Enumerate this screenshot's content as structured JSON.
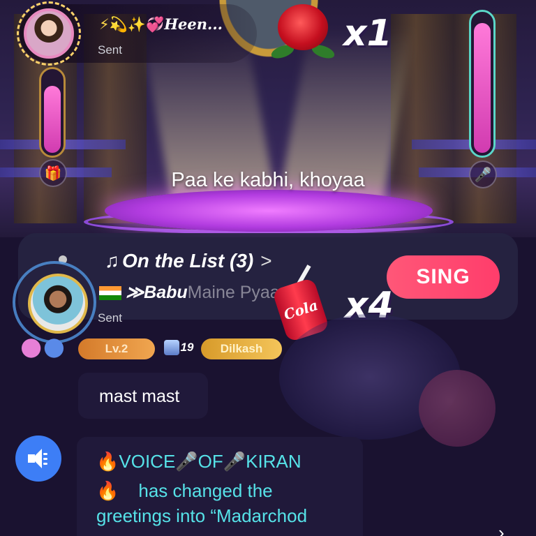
{
  "stage": {
    "lyric": "Paa ke kabhi, khoyaa"
  },
  "gift_banner_top": {
    "sender_emoji": "⚡💫✨💞",
    "sender_name": "Heen...",
    "status": "Sent",
    "multiplier": "x1",
    "gift": "rose-icon"
  },
  "song_list": {
    "title": "On the List (3)",
    "chevron": ">",
    "song_name": "≫Babu",
    "song_sub": "Maine Pyaam Li",
    "sing_label": "SING"
  },
  "gift_banner_second": {
    "status": "Sent",
    "multiplier": "x4",
    "gift_label": "Cola"
  },
  "badges": {
    "level": "Lv.2",
    "rank": "19",
    "club": "Dilkash"
  },
  "chat": {
    "messages": [
      {
        "text": "mast mast"
      }
    ],
    "notice": {
      "line1": "VOICE🎤OF🎤KIRAN",
      "line2": "has changed the",
      "line3": "greetings into “Madarchod"
    }
  },
  "colors": {
    "sing_button": "#ff4a70",
    "notice_text": "#56e2e8",
    "speaker_button": "#3d7ef6",
    "level_badge": "#e08a36"
  }
}
